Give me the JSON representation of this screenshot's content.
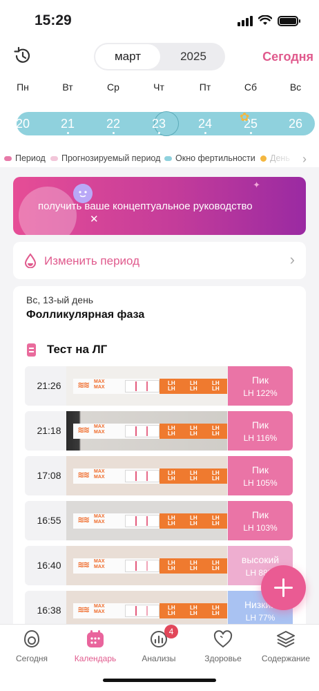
{
  "status_bar": {
    "time": "15:29"
  },
  "header": {
    "month": "март",
    "year": "2025",
    "today_button": "Сегодня"
  },
  "weekdays": [
    "Пн",
    "Вт",
    "Ср",
    "Чт",
    "Пт",
    "Сб",
    "Вс"
  ],
  "dates": [
    {
      "label": "20",
      "dot": false
    },
    {
      "label": "21",
      "dot": true
    },
    {
      "label": "22",
      "dot": true
    },
    {
      "label": "23",
      "dot": true,
      "today": true
    },
    {
      "label": "24",
      "dot": true
    },
    {
      "label": "25",
      "dot": true,
      "ovulation": true
    },
    {
      "label": "26",
      "dot": false
    }
  ],
  "legend": [
    {
      "label": "Период",
      "color": "#e77aa8"
    },
    {
      "label": "Прогнозируемый период",
      "color": "#f2c6d9"
    },
    {
      "label": "Окно фертильности",
      "color": "#8fd1dd"
    },
    {
      "label": "День",
      "color": "#f4b740"
    }
  ],
  "banner": {
    "text": "получить ваше концептуальное руководство"
  },
  "change_period": {
    "label": "Изменить период"
  },
  "cycle": {
    "day_label": "Вс, 13-ый день",
    "phase": "Фолликулярная фаза"
  },
  "lh_section": {
    "title": "Тест на ЛГ",
    "tests": [
      {
        "time": "21:26",
        "level": "Пик",
        "percent": "LH 122%",
        "color": "#ea74a6"
      },
      {
        "time": "21:18",
        "level": "Пик",
        "percent": "LH 116%",
        "color": "#ea74a6"
      },
      {
        "time": "17:08",
        "level": "Пик",
        "percent": "LH 105%",
        "color": "#ea74a6"
      },
      {
        "time": "16:55",
        "level": "Пик",
        "percent": "LH 103%",
        "color": "#ea74a6"
      },
      {
        "time": "16:40",
        "level": "высокий",
        "percent": "LH 88%",
        "color": "#eeaed0"
      },
      {
        "time": "16:38",
        "level": "Низкий",
        "percent": "LH 77%",
        "color": "#a9c2f2"
      }
    ]
  },
  "tabs": [
    {
      "label": "Сегодня",
      "active": false
    },
    {
      "label": "Календарь",
      "active": true
    },
    {
      "label": "Анализы",
      "active": false,
      "badge": "4"
    },
    {
      "label": "Здоровье",
      "active": false
    },
    {
      "label": "Содержание",
      "active": false
    }
  ]
}
